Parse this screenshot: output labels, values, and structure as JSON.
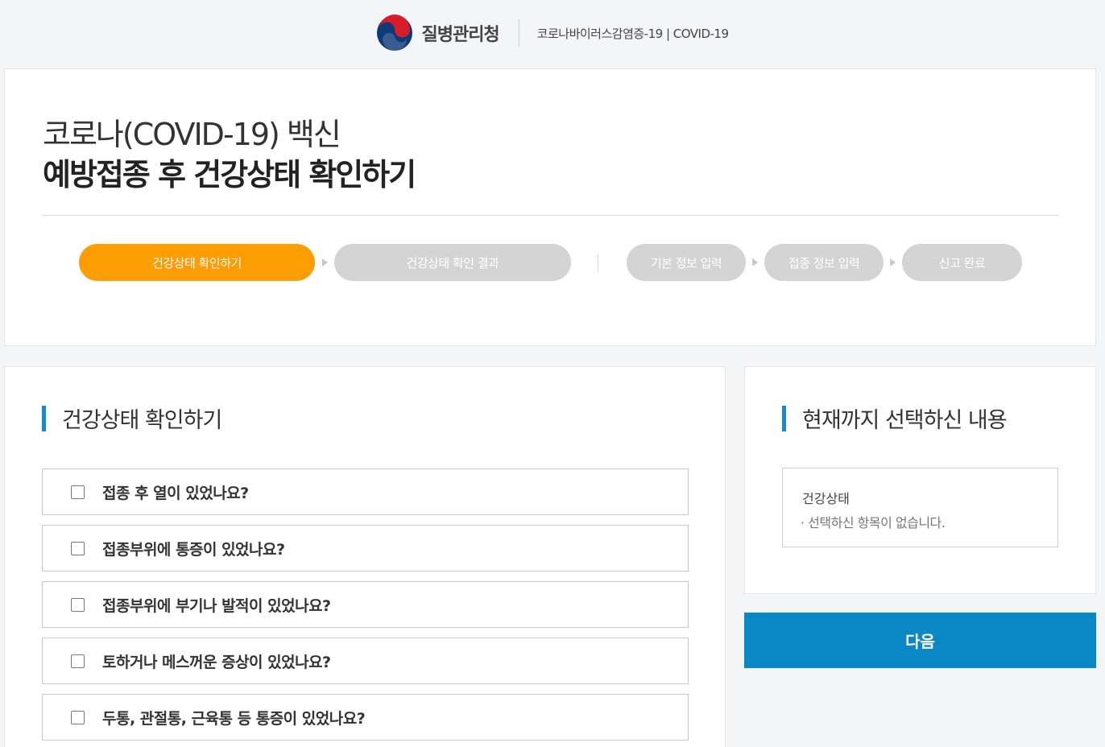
{
  "header": {
    "agency_name": "질병관리청",
    "site_name": "코로나바이러스감염증-19 | COVID-19"
  },
  "title": {
    "line1": "코로나(COVID-19) 백신",
    "line2": "예방접종 후 건강상태 확인하기"
  },
  "steps": [
    {
      "label": "건강상태 확인하기",
      "active": true
    },
    {
      "label": "건강상태 확인 결과",
      "active": false
    },
    {
      "label": "기본 정보 입력",
      "active": false
    },
    {
      "label": "접종 정보 입력",
      "active": false
    },
    {
      "label": "신고 완료",
      "active": false
    }
  ],
  "questions_section": {
    "title": "건강상태 확인하기",
    "items": [
      {
        "label": "접종 후 열이 있었나요?",
        "checked": false
      },
      {
        "label": "접종부위에 통증이 있었나요?",
        "checked": false
      },
      {
        "label": "접종부위에 부기나 발적이 있었나요?",
        "checked": false
      },
      {
        "label": "토하거나 메스꺼운 증상이 있었나요?",
        "checked": false
      },
      {
        "label": "두통, 관절통, 근육통 등 통증이 있었나요?",
        "checked": false
      }
    ]
  },
  "summary_section": {
    "title": "현재까지 선택하신 내용",
    "category_label": "건강상태",
    "empty_message": "· 선택하신 항목이 없습니다."
  },
  "next_button": {
    "label": "다음"
  },
  "colors": {
    "accent_orange": "#fb9d03",
    "accent_blue": "#0a88c6",
    "inactive_step": "#d4d4d4"
  }
}
